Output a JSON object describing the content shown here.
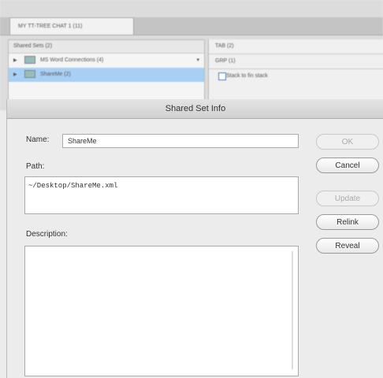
{
  "background_window": {
    "tab_label": "MY TT-TREE CHAT 1 (11)",
    "left_panel": {
      "header": "Shared Sets (2)",
      "rows": [
        {
          "label": "MS Word Connections (4)",
          "selected": false
        },
        {
          "label": "ShareMe (2)",
          "selected": true
        }
      ]
    },
    "right_panel": {
      "rows": [
        "TAB (2)",
        "GRP (1)"
      ],
      "checkbox_label": "Stack to fin stack"
    }
  },
  "dialog": {
    "title": "Shared Set Info",
    "name_label": "Name:",
    "name_value": "ShareMe",
    "path_label": "Path:",
    "path_value": "~/Desktop/ShareMe.xml",
    "description_label": "Description:",
    "description_value": "",
    "buttons": {
      "ok": "OK",
      "cancel": "Cancel",
      "update": "Update",
      "relink": "Relink",
      "reveal": "Reveal"
    }
  }
}
